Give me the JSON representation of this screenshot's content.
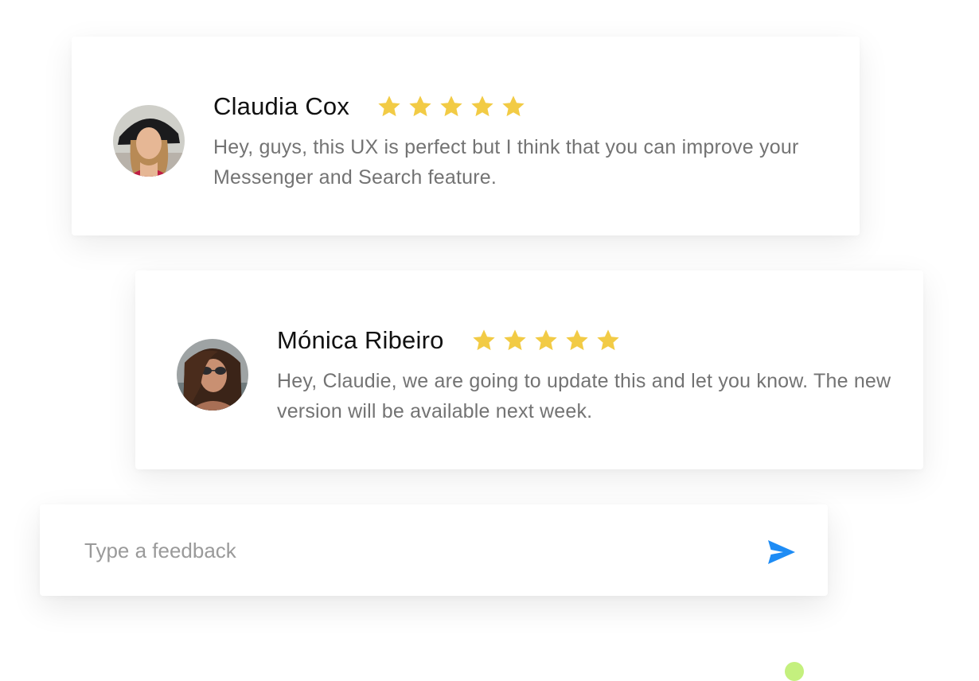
{
  "reviews": [
    {
      "name": "Claudia Cox",
      "rating": 5,
      "message": "Hey, guys, this UX is perfect but I think that you can improve your Messenger and Search feature."
    },
    {
      "name": "Mónica Ribeiro",
      "rating": 5,
      "message": "Hey, Claudie, we are going to update this and let you know. The new version will be available next week."
    }
  ],
  "feedback": {
    "placeholder": "Type a feedback",
    "value": ""
  },
  "icons": {
    "star": "star-icon",
    "send": "send-icon"
  },
  "colors": {
    "star": "#F2CB45",
    "send": "#1E8CF5",
    "accent_dot": "#C4F07E",
    "name": "#111111",
    "message": "#737373",
    "placeholder": "#9A9A9A"
  }
}
